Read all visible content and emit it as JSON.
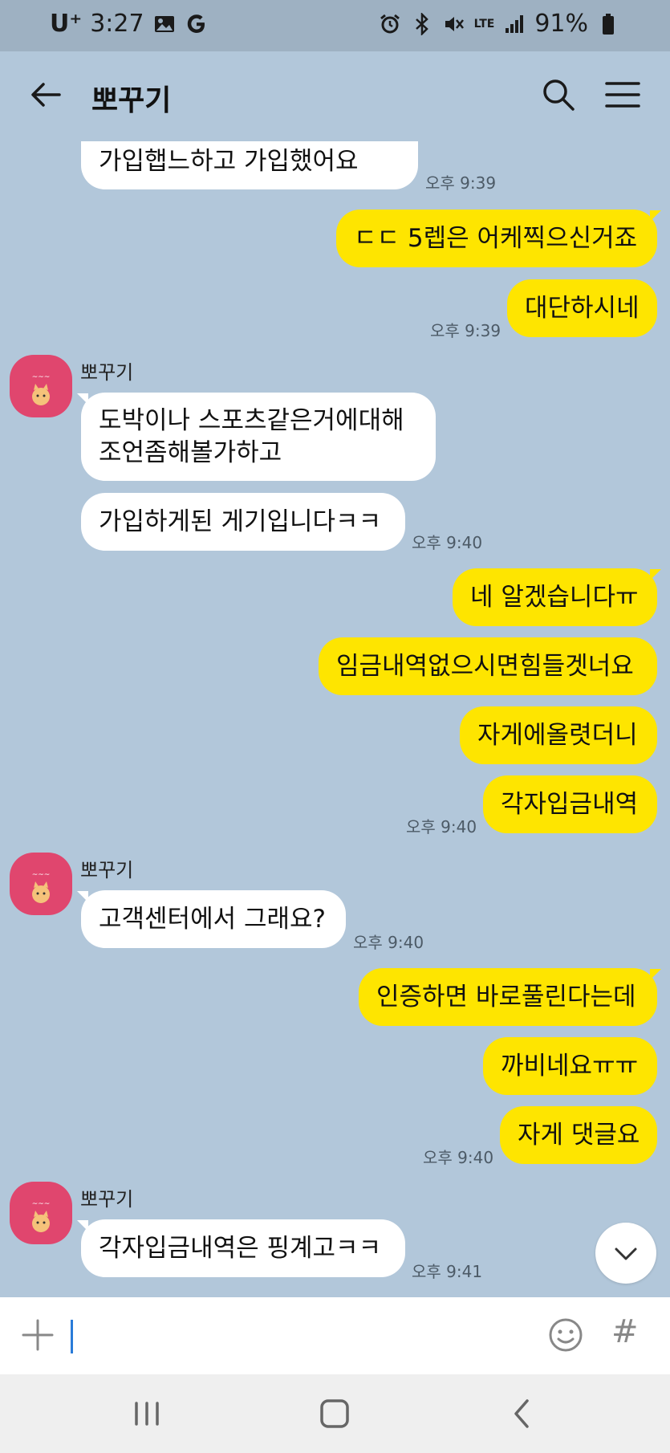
{
  "status_bar": {
    "carrier": "U⁺",
    "time": "3:27",
    "network": "LTE",
    "battery": "91%"
  },
  "header": {
    "title": "뽀꾸기"
  },
  "messages": [
    {
      "side": "left",
      "text": "가입햅느하고 가입했어요",
      "time": "오후 9:39"
    },
    {
      "side": "right",
      "text": "ㄷㄷ 5렙은 어케찍으신거죠",
      "time": ""
    },
    {
      "side": "right",
      "text": "대단하시네",
      "time": "오후 9:39"
    },
    {
      "side": "left",
      "sender": "뽀꾸기",
      "text": "도박이나 스포츠같은거에대해 조언좀해볼가하고",
      "time": ""
    },
    {
      "side": "left",
      "text": "가입하게된 게기입니다ㅋㅋ",
      "time": "오후 9:40"
    },
    {
      "side": "right",
      "text": "네 알겠습니다ㅠ",
      "time": ""
    },
    {
      "side": "right",
      "text": "임금내역없으시면힘들겟너요",
      "time": ""
    },
    {
      "side": "right",
      "text": "자게에올렷더니",
      "time": ""
    },
    {
      "side": "right",
      "text": "각자입금내역",
      "time": "오후 9:40"
    },
    {
      "side": "left",
      "sender": "뽀꾸기",
      "text": "고객센터에서 그래요?",
      "time": "오후 9:40"
    },
    {
      "side": "right",
      "text": "인증하면 바로풀린다는데",
      "time": ""
    },
    {
      "side": "right",
      "text": "까비네요ㅠㅠ",
      "time": ""
    },
    {
      "side": "right",
      "text": "자게 댓글요",
      "time": "오후 9:40"
    },
    {
      "side": "left",
      "sender": "뽀꾸기",
      "text": "각자입금내역은 핑계고ㅋㅋ",
      "time": "오후 9:41"
    }
  ],
  "input": {
    "value": "",
    "placeholder": ""
  },
  "hash_label": "#",
  "colors": {
    "background": "#b2c7da",
    "my_bubble": "#fee500",
    "their_bubble": "#ffffff",
    "avatar": "#e0466e"
  }
}
